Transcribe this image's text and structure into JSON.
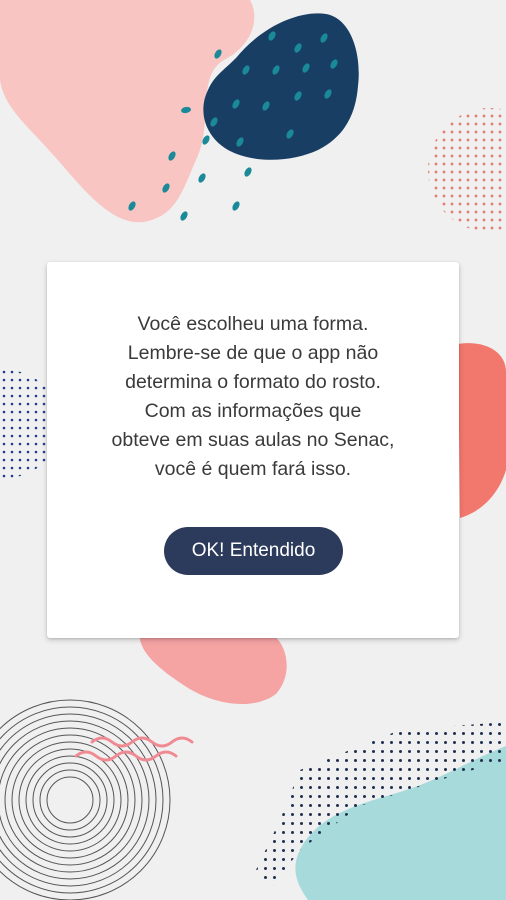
{
  "dialog": {
    "message": "Você escolheu uma forma.\nLembre-se de que o app não\ndetermina o formato do rosto.\nCom as informações que\nobteve em suas aulas no Senac,\nvocê é quem fará isso.",
    "ok_button_label": "OK! Entendido"
  },
  "colors": {
    "background": "#f0f0f0",
    "pink_blob": "#f9c5c3",
    "navy_blob": "#183e63",
    "teal_dots": "#1a8a98",
    "coral_blob": "#f2776c",
    "coral_dots": "#e67c70",
    "blue_dots": "#1e3d8a",
    "wave": "#f08a92",
    "circle_lines": "#555555",
    "teal_blob": "#a6dadb",
    "dialog_background": "#ffffff",
    "button_background": "#2c3a5c",
    "button_text": "#ffffff",
    "message_text": "#3a3a3a"
  }
}
